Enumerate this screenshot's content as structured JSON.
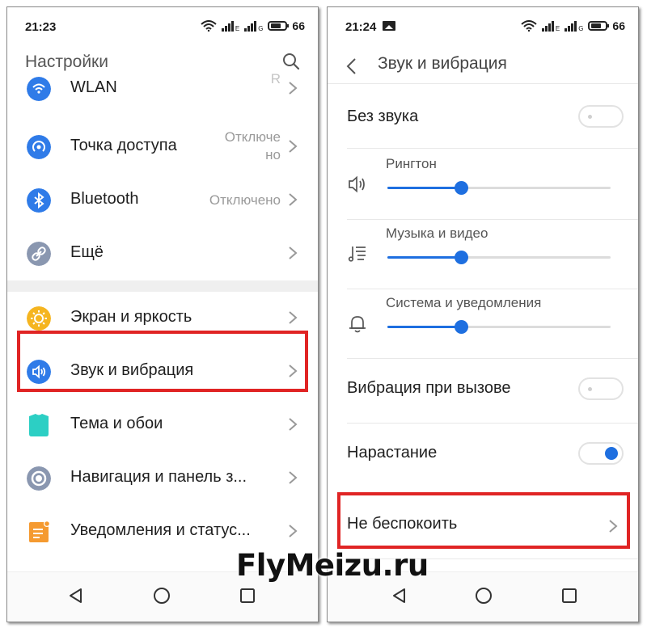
{
  "left_screen": {
    "status": {
      "time": "21:23",
      "signal1_label": "E",
      "signal2_label": "G",
      "battery": "66"
    },
    "title": "Настройки",
    "items": [
      {
        "label": "WLAN",
        "value": "",
        "icon": "wifi-icon",
        "color": "#2f7be8"
      },
      {
        "label": "Точка доступа",
        "value": "Отключе\nно",
        "icon": "hotspot-icon",
        "color": "#2f7be8"
      },
      {
        "label": "Bluetooth",
        "value": "Отключено",
        "icon": "bluetooth-icon",
        "color": "#2f7be8"
      },
      {
        "label": "Ещё",
        "value": "",
        "icon": "link-icon",
        "color": "#8a97b0"
      },
      {
        "label": "Экран и яркость",
        "value": "",
        "icon": "sun-icon",
        "color": "#f5b520"
      },
      {
        "label": "Звук и вибрация",
        "value": "",
        "icon": "speaker-icon",
        "color": "#2f7be8"
      },
      {
        "label": "Тема и обои",
        "value": "",
        "icon": "shirt-icon",
        "color": "#2ccfc4"
      },
      {
        "label": "Навигация и панель з...",
        "value": "",
        "icon": "target-icon",
        "color": "#8a97b0"
      },
      {
        "label": "Уведомления и статус...",
        "value": "",
        "icon": "notification-icon",
        "color": "#f59a30"
      }
    ]
  },
  "right_screen": {
    "status": {
      "time": "21:24",
      "signal1_label": "E",
      "signal2_label": "G",
      "battery": "66"
    },
    "title": "Звук и вибрация",
    "silent_label": "Без звука",
    "silent_on": false,
    "volumes": [
      {
        "label": "Рингтон",
        "level": 0.33,
        "icon": "speaker-outline-icon"
      },
      {
        "label": "Музыка и видео",
        "level": 0.33,
        "icon": "music-list-icon"
      },
      {
        "label": "Система и уведомления",
        "level": 0.33,
        "icon": "bell-icon"
      }
    ],
    "vibrate_label": "Вибрация при вызове",
    "vibrate_on": false,
    "fade_label": "Нарастание",
    "fade_on": true,
    "dnd_label": "Не беспокоить"
  },
  "watermark": "FlyMeizu.ru",
  "colors": {
    "accent": "#1e6fe0",
    "highlight": "#e02424"
  }
}
